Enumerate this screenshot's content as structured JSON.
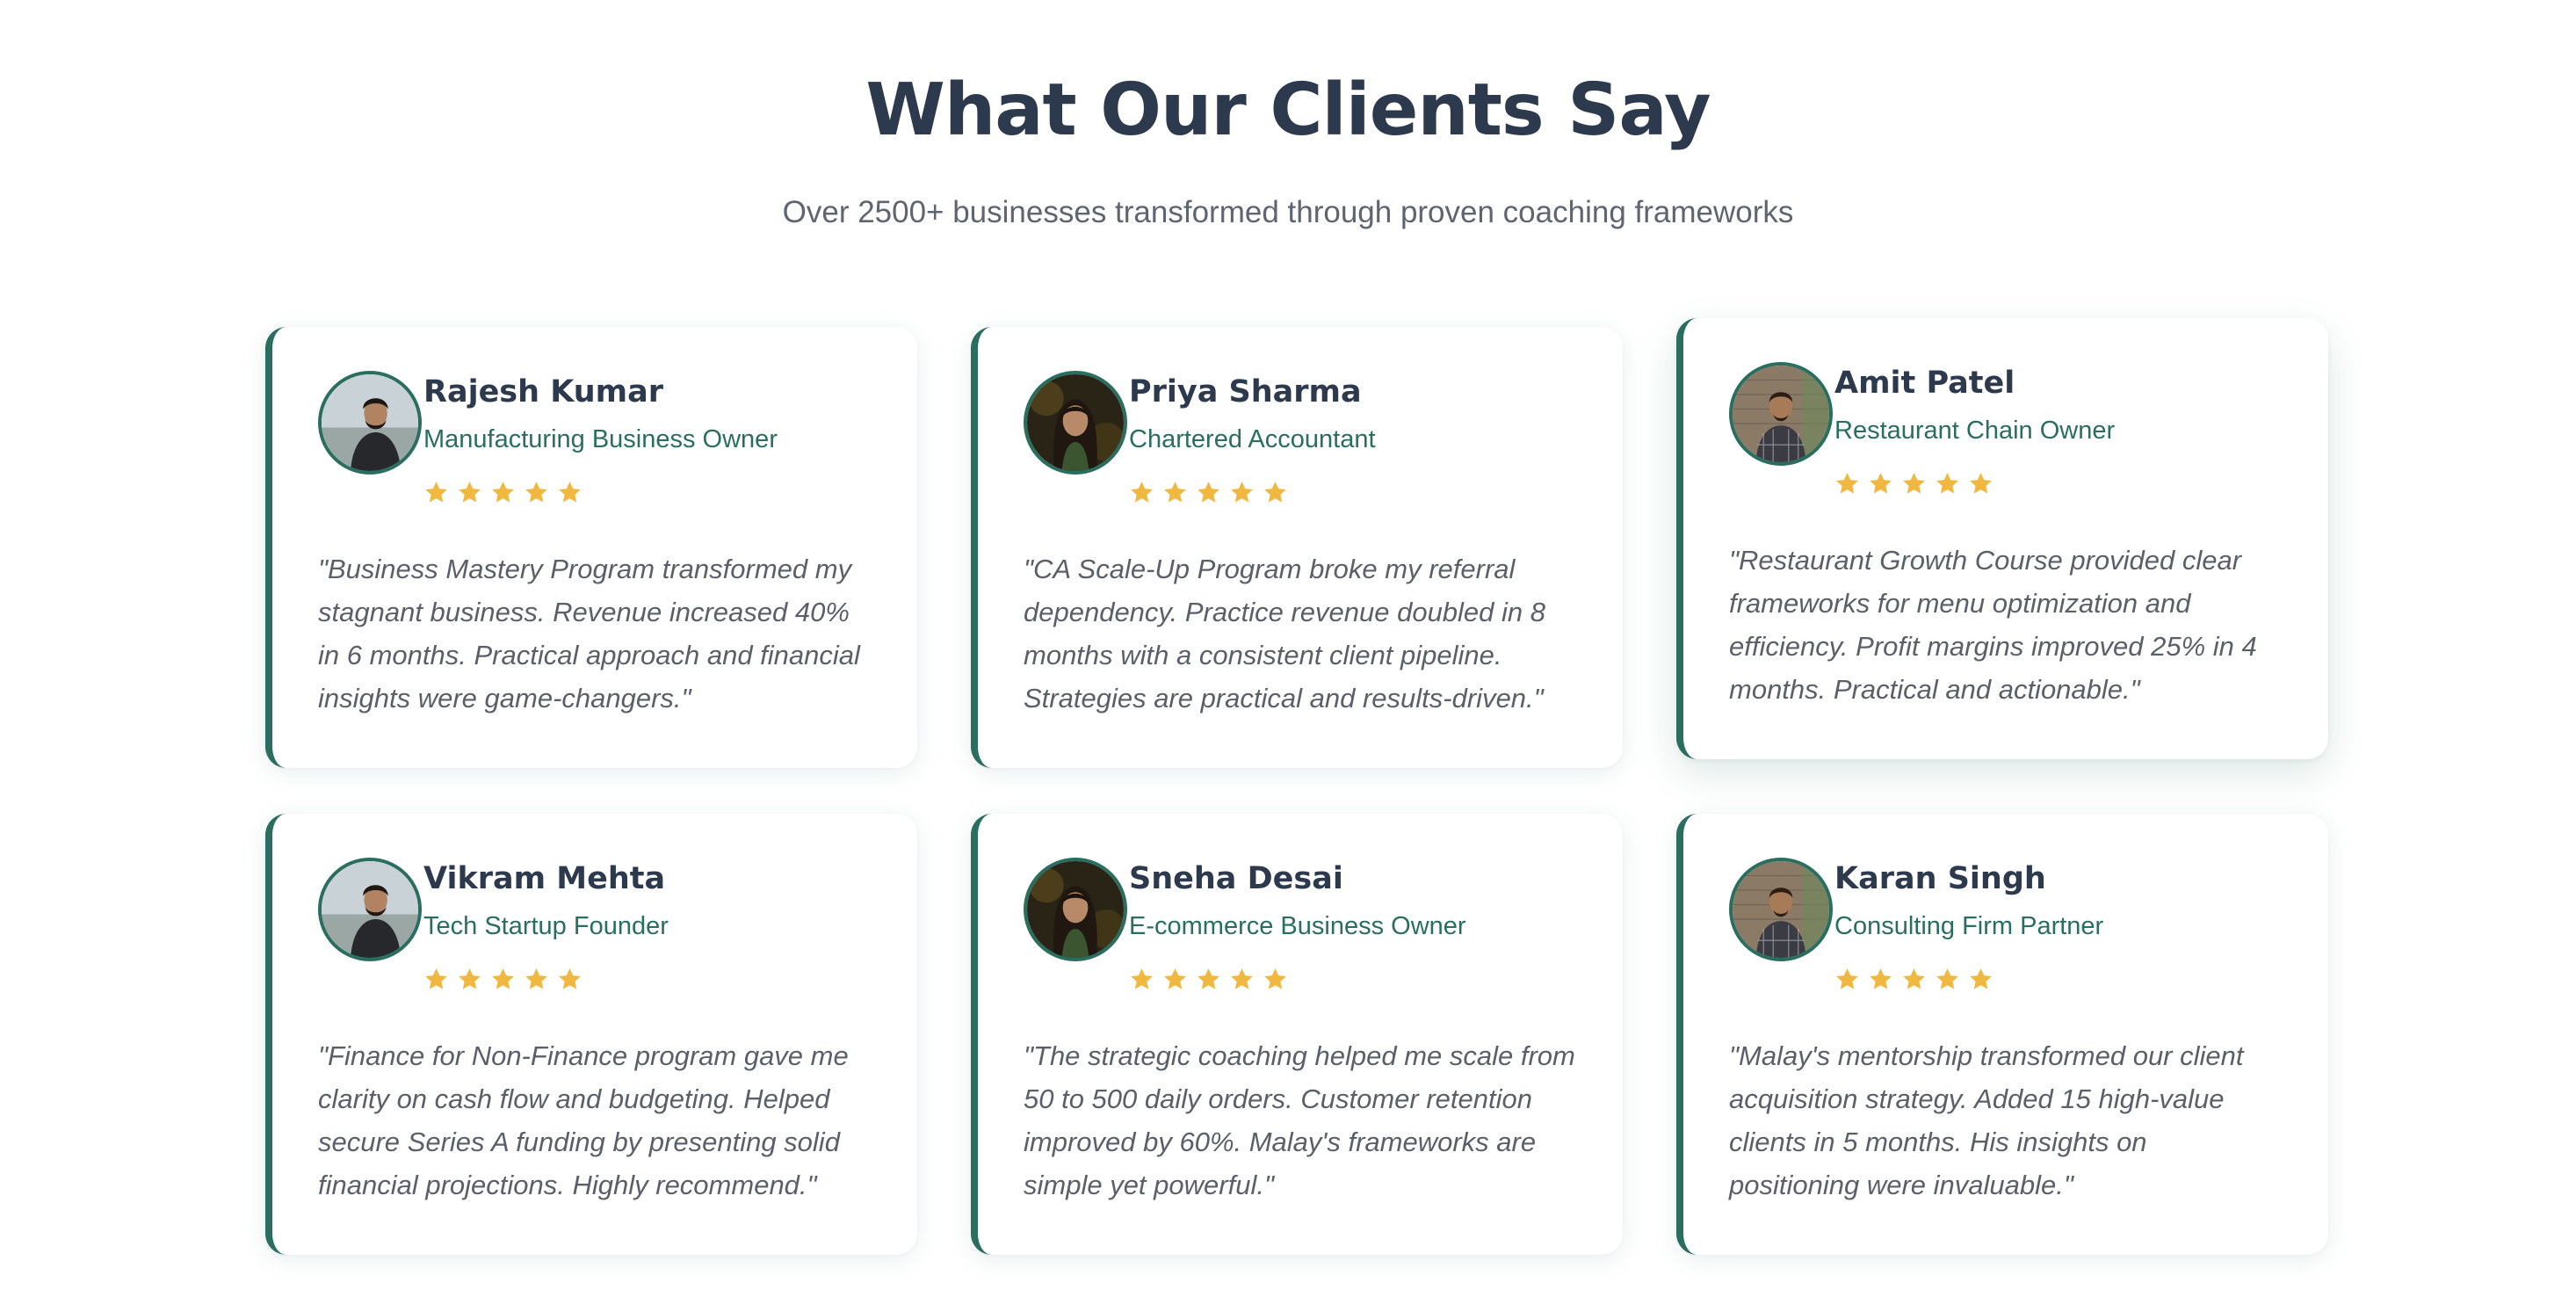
{
  "section": {
    "title": "What Our Clients Say",
    "subtitle": "Over 2500+ businesses transformed through proven coaching frameworks"
  },
  "colors": {
    "accent": "#2a6e5f",
    "star": "#f0b840",
    "heading": "#2d3a4e"
  },
  "testimonials": [
    {
      "name": "Rajesh Kumar",
      "role": "Manufacturing Business Owner",
      "rating": 5,
      "avatar": "avatar-man-outdoor",
      "quote": "\"Business Mastery Program transformed my stagnant business. Revenue increased 40% in 6 months. Practical approach and financial insights were game-changers.\""
    },
    {
      "name": "Priya Sharma",
      "role": "Chartered Accountant",
      "rating": 5,
      "avatar": "avatar-woman-dark",
      "quote": "\"CA Scale-Up Program broke my referral dependency. Practice revenue doubled in 8 months with a consistent client pipeline. Strategies are practical and results-driven.\""
    },
    {
      "name": "Amit Patel",
      "role": "Restaurant Chain Owner",
      "rating": 5,
      "avatar": "avatar-man-brick",
      "quote": "\"Restaurant Growth Course provided clear frameworks for menu optimization and efficiency. Profit margins improved 25% in 4 months. Practical and actionable.\""
    },
    {
      "name": "Vikram Mehta",
      "role": "Tech Startup Founder",
      "rating": 5,
      "avatar": "avatar-man-outdoor",
      "quote": "\"Finance for Non-Finance program gave me clarity on cash flow and budgeting. Helped secure Series A funding by presenting solid financial projections. Highly recommend.\""
    },
    {
      "name": "Sneha Desai",
      "role": "E-commerce Business Owner",
      "rating": 5,
      "avatar": "avatar-woman-dark",
      "quote": "\"The strategic coaching helped me scale from 50 to 500 daily orders. Customer retention improved by 60%. Malay's frameworks are simple yet powerful.\""
    },
    {
      "name": "Karan Singh",
      "role": "Consulting Firm Partner",
      "rating": 5,
      "avatar": "avatar-man-brick",
      "quote": "\"Malay's mentorship transformed our client acquisition strategy. Added 15 high-value clients in 5 months. His insights on positioning were invaluable.\""
    }
  ]
}
